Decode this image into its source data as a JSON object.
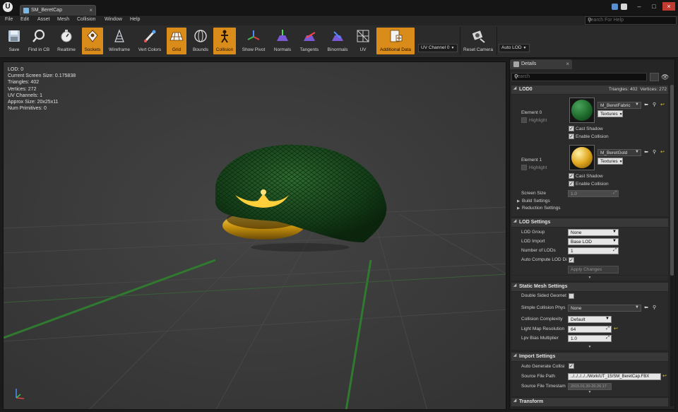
{
  "window": {
    "tab_title": "SM_BeretCap",
    "logo": "U"
  },
  "menu": {
    "items": [
      "File",
      "Edit",
      "Asset",
      "Mesh",
      "Collision",
      "Window",
      "Help"
    ],
    "help_search_placeholder": "Search For Help"
  },
  "toolbar": {
    "buttons": [
      {
        "label": "Save",
        "icon": "save-icon",
        "active": false
      },
      {
        "label": "Find in CB",
        "icon": "find-in-cb-icon",
        "active": false
      },
      {
        "label": "Realtime",
        "icon": "realtime-icon",
        "active": false
      },
      {
        "label": "Sockets",
        "icon": "sockets-icon",
        "active": true
      },
      {
        "label": "Wireframe",
        "icon": "wireframe-icon",
        "active": false
      },
      {
        "label": "Vert Colors",
        "icon": "vert-colors-icon",
        "active": false
      },
      {
        "label": "Grid",
        "icon": "grid-icon",
        "active": true
      },
      {
        "label": "Bounds",
        "icon": "bounds-icon",
        "active": false
      },
      {
        "label": "Collision",
        "icon": "collision-icon",
        "active": true
      },
      {
        "label": "Show Pivot",
        "icon": "show-pivot-icon",
        "active": false
      },
      {
        "label": "Normals",
        "icon": "normals-icon",
        "active": false
      },
      {
        "label": "Tangents",
        "icon": "tangents-icon",
        "active": false
      },
      {
        "label": "Binormals",
        "icon": "binormals-icon",
        "active": false
      },
      {
        "label": "UV",
        "icon": "uv-icon",
        "active": false
      },
      {
        "label": "Additional Data",
        "icon": "additional-data-icon",
        "active": true
      },
      {
        "label": "Reset Camera",
        "icon": "reset-camera-icon",
        "active": false
      }
    ],
    "uv_channel": "UV Channel 0",
    "lod_combo": "Auto LOD"
  },
  "viewport": {
    "stats": [
      "LOD:  0",
      "Current Screen Size:  0.175838",
      "Triangles:  402",
      "Vertices:  272",
      "UV Channels:  1",
      "Approx Size: 20x25x11",
      "Num Primitives:  0"
    ]
  },
  "details": {
    "tab_label": "Details",
    "search_placeholder": "Search",
    "lod0": {
      "header": "LOD0",
      "triangles": "Triangles: 402",
      "vertices": "Vertices: 272",
      "elements": [
        {
          "label": "Element 0",
          "highlight": "Highlight",
          "material": "M_BeretFabric",
          "textures": "Textures",
          "cast_shadow": "Cast Shadow",
          "enable_collision": "Enable Collision",
          "color": "#1f6b2c"
        },
        {
          "label": "Element 1",
          "highlight": "Highlight",
          "material": "M_BeretGold",
          "textures": "Textures",
          "cast_shadow": "Cast Shadow",
          "enable_collision": "Enable Collision",
          "color": "#d9a21d"
        }
      ],
      "screen_size_label": "Screen Size",
      "screen_size_value": "1.0",
      "build_settings": "Build Settings",
      "reduction_settings": "Reduction Settings"
    },
    "lod_settings": {
      "header": "LOD Settings",
      "lod_group_label": "LOD Group",
      "lod_group_value": "None",
      "lod_import_label": "LOD Import",
      "lod_import_value": "Base LOD",
      "num_lods_label": "Number of LODs",
      "num_lods_value": "1",
      "auto_compute_label": "Auto Compute LOD Di",
      "apply_changes": "Apply Changes"
    },
    "static_mesh": {
      "header": "Static Mesh Settings",
      "double_sided_label": "Double Sided Geomet",
      "simple_collision_label": "Simple Collision Phys",
      "simple_collision_value": "None",
      "collision_complexity_label": "Collision Complexity",
      "collision_complexity_value": "Default",
      "light_map_label": "Light Map Resolution",
      "light_map_value": "64",
      "lpv_bias_label": "Lpv Bias Multiplier",
      "lpv_bias_value": "1.0"
    },
    "import_settings": {
      "header": "Import Settings",
      "auto_generate_label": "Auto Generate Collisi",
      "source_path_label": "Source File Path",
      "source_path_value": "../../../../../Work/UT_15/SM_BeretCap.FBX",
      "source_timestamp_label": "Source File Timestam",
      "source_timestamp_value": "2015.01.30-20.26.17"
    },
    "transform_header": "Transform"
  }
}
